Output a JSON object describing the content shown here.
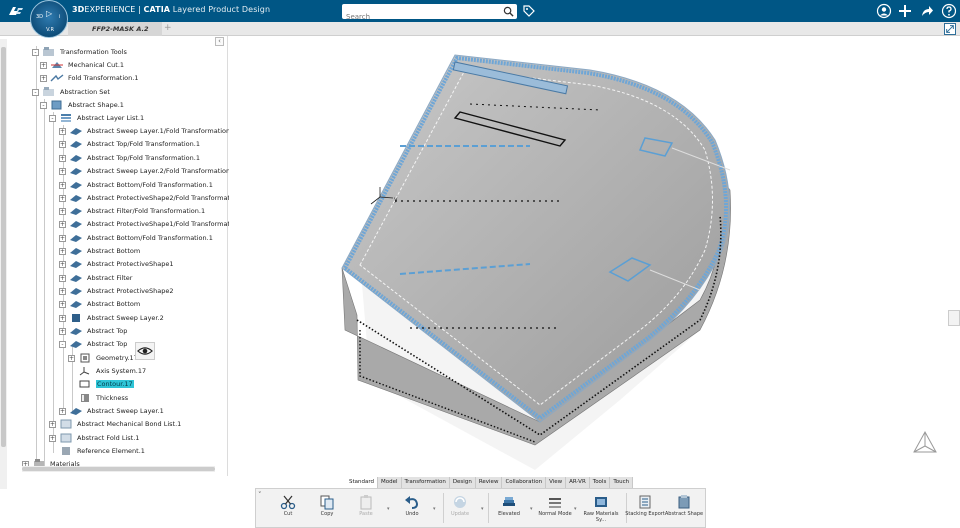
{
  "header": {
    "brand_bold": "3D",
    "brand_rest": "EXPERIENCE | ",
    "app": "CATIA",
    "app_sub": " Layered Product Design",
    "search_placeholder": "Search",
    "compass_version": "V.R",
    "compass_3d": "3D",
    "compass_i": "i"
  },
  "tab": {
    "title": "FFP2-MASK A.2"
  },
  "tree": {
    "nodes": [
      {
        "label": "Transformation Tools",
        "toggle": "-"
      },
      {
        "label": "Mechanical Cut.1",
        "toggle": "+"
      },
      {
        "label": "Fold Transformation.1",
        "toggle": "+"
      },
      {
        "label": "Abstraction Set",
        "toggle": "-"
      },
      {
        "label": "Abstract Shape.1",
        "toggle": "-"
      },
      {
        "label": "Abstract Layer List.1",
        "toggle": "-"
      },
      {
        "label": "Abstract Sweep Layer.1/Fold Transformation.1",
        "toggle": "+"
      },
      {
        "label": "Abstract Top/Fold Transformation.1",
        "toggle": "+"
      },
      {
        "label": "Abstract Top/Fold Transformation.1",
        "toggle": "+"
      },
      {
        "label": "Abstract Sweep Layer.2/Fold Transformation.1",
        "toggle": "+"
      },
      {
        "label": "Abstract Bottom/Fold Transformation.1",
        "toggle": "+"
      },
      {
        "label": "Abstract ProtectiveShape2/Fold Transformatio",
        "toggle": "+"
      },
      {
        "label": "Abstract Filter/Fold Transformation.1",
        "toggle": "+"
      },
      {
        "label": "Abstract ProtectiveShape1/Fold Transformatio",
        "toggle": "+"
      },
      {
        "label": "Abstract Bottom/Fold Transformation.1",
        "toggle": "+"
      },
      {
        "label": "Abstract Bottom",
        "toggle": "+"
      },
      {
        "label": "Abstract ProtectiveShape1",
        "toggle": "+"
      },
      {
        "label": "Abstract Filter",
        "toggle": "+"
      },
      {
        "label": "Abstract ProtectiveShape2",
        "toggle": "+"
      },
      {
        "label": "Abstract Bottom",
        "toggle": "+"
      },
      {
        "label": "Abstract Sweep Layer.2",
        "toggle": "+"
      },
      {
        "label": "Abstract Top",
        "toggle": "+"
      },
      {
        "label": "Abstract Top",
        "toggle": "-"
      },
      {
        "label": "Geometry.17",
        "toggle": "+"
      },
      {
        "label": "Axis System.17",
        "toggle": ""
      },
      {
        "label": "Contour.17",
        "toggle": ""
      },
      {
        "label": "Thickness",
        "toggle": ""
      },
      {
        "label": "Abstract Sweep Layer.1",
        "toggle": "+"
      },
      {
        "label": "Abstract Mechanical Bond List.1",
        "toggle": "+"
      },
      {
        "label": "Abstract Fold List.1",
        "toggle": "+"
      },
      {
        "label": "Reference Element.1",
        "toggle": ""
      },
      {
        "label": "Materials",
        "toggle": "+"
      }
    ]
  },
  "actionbar": {
    "tabs": [
      "Standard",
      "Model",
      "Transformation",
      "Design",
      "Review",
      "Collaboration",
      "View",
      "AR-VR",
      "Tools",
      "Touch"
    ],
    "active_tab": "Standard",
    "tools": {
      "cut": "Cut",
      "copy": "Copy",
      "paste": "Paste",
      "undo": "Undo",
      "update": "Update",
      "elevated": "Elevated",
      "normal_mode": "Normal Mode",
      "raw_materials": "Raw Materials Sy...",
      "stacking_export": "Stacking Export",
      "abstract_shape": "Abstract Shape"
    }
  },
  "colors": {
    "topbar": "#005685",
    "highlight": "#2ec4d6",
    "accent_blue": "#5b9fd4"
  }
}
